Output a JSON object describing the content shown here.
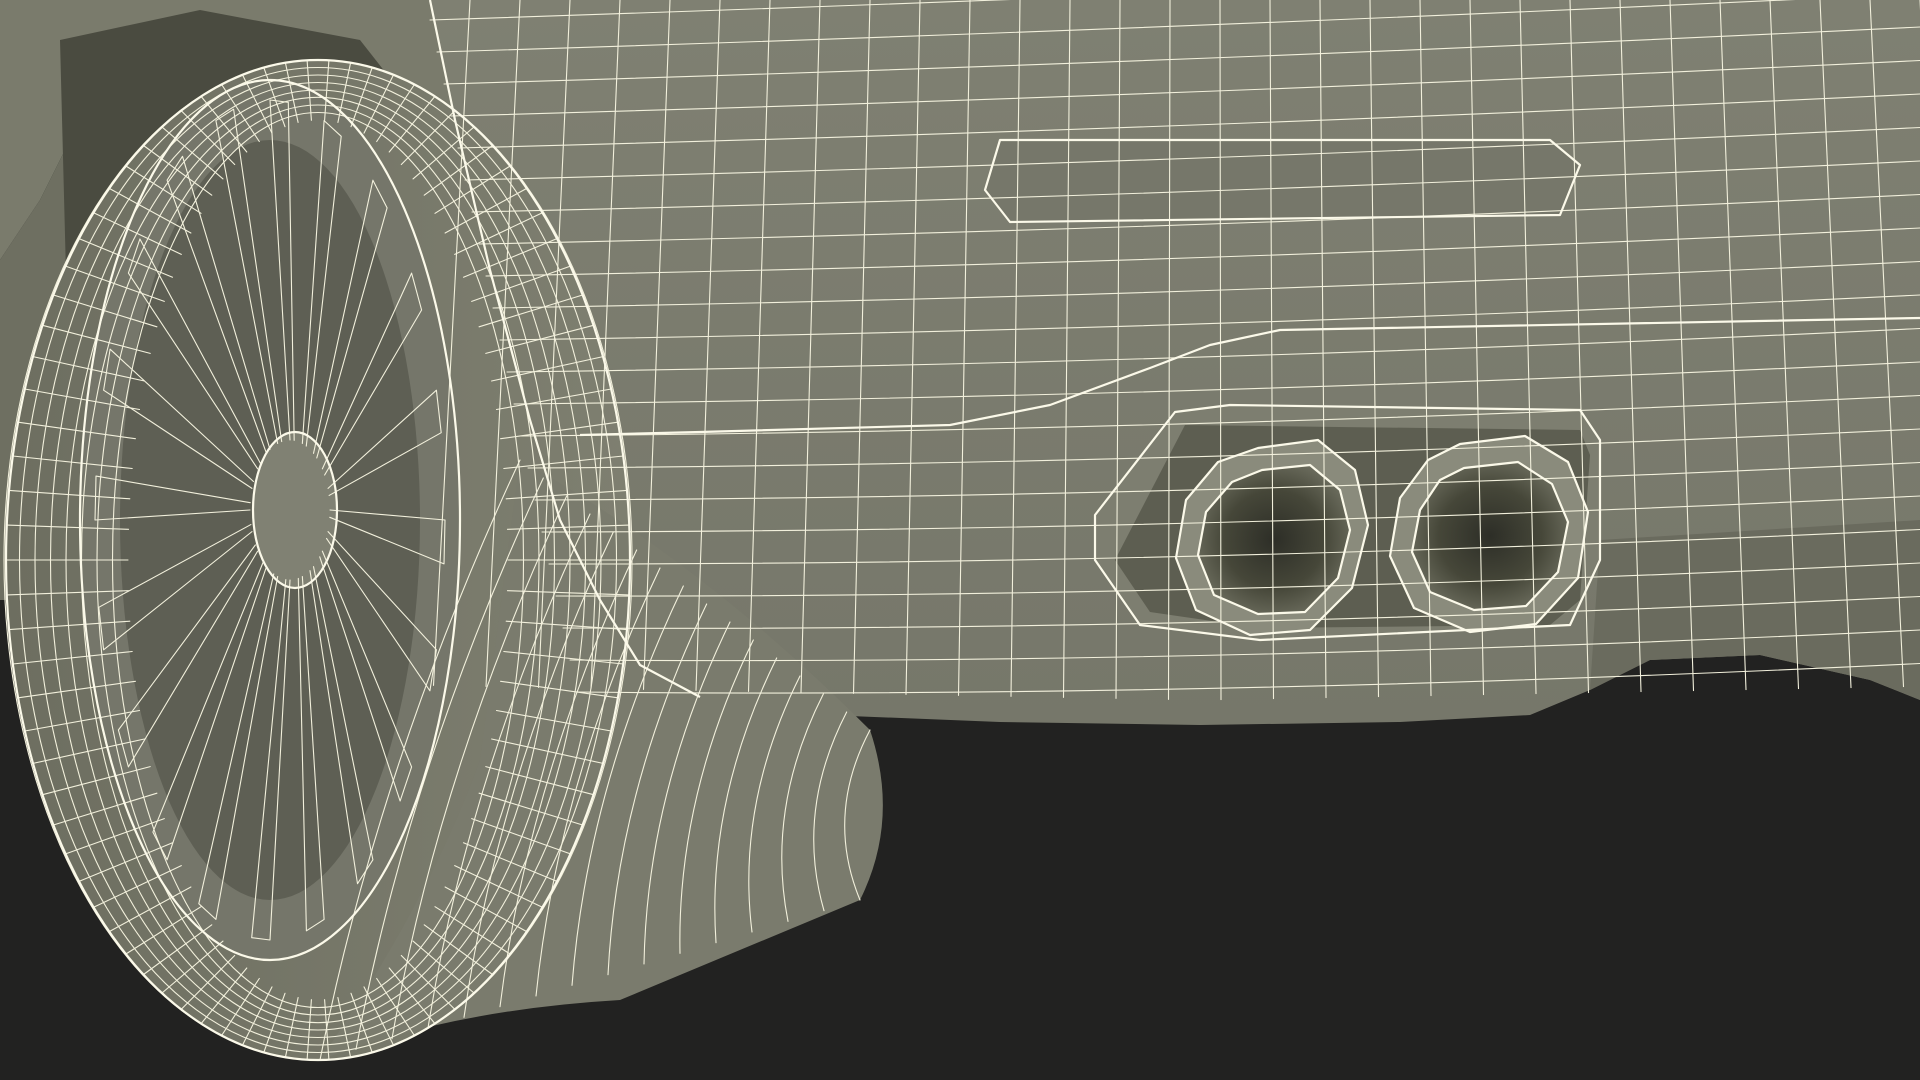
{
  "scene": {
    "subject": "car-rear-wheel-and-exhaust-wireframe"
  },
  "colors": {
    "background": "#222221",
    "surface": "#7c7d6d",
    "surface_light": "#84857a",
    "surface_dark": "#5d5e52",
    "cavity": "#3a3b33",
    "wire": "#f2f0dc"
  }
}
